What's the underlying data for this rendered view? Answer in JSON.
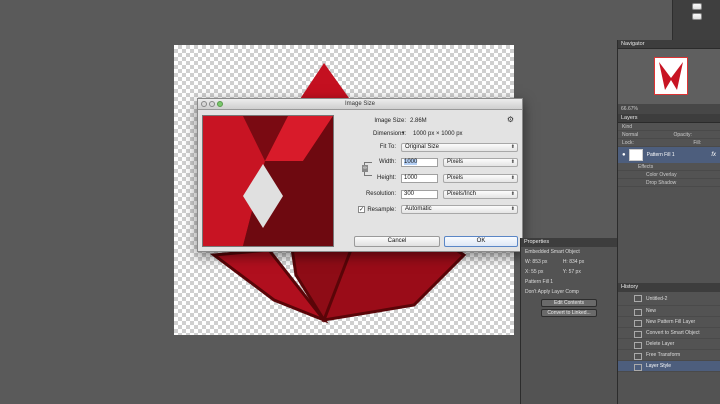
{
  "dialog": {
    "title": "Image Size",
    "image_size_label": "Image Size:",
    "image_size_value": "2.86M",
    "dimensions_label": "Dimensions:",
    "dimensions_value": "1000 px  ×  1000 px",
    "fit_to_label": "Fit To:",
    "fit_to_value": "Original Size",
    "width_label": "Width:",
    "width_value": "1000",
    "width_unit": "Pixels",
    "height_label": "Height:",
    "height_value": "1000",
    "height_unit": "Pixels",
    "resolution_label": "Resolution:",
    "resolution_value": "300",
    "resolution_unit": "Pixels/Inch",
    "resample_label": "Resample:",
    "resample_value": "Automatic",
    "resample_checked": "✓",
    "cancel_label": "Cancel",
    "ok_label": "OK"
  },
  "dock": {
    "navigator_tab": "Navigator",
    "zoom": "66.67%",
    "layers_tab": "Layers",
    "kind_filter": "Kind",
    "blend_mode": "Normal",
    "opacity_label": "Opacity:",
    "fill_label": "Fill:",
    "lock_label": "Lock:",
    "layer_name": "Pattern Fill 1",
    "fx": "fx",
    "effects_label": "Effects",
    "effect_1": "Color Overlay",
    "effect_2": "Drop Shadow"
  },
  "properties": {
    "tab": "Properties",
    "type": "Embedded Smart Object",
    "w": "W: 853 px",
    "h": "H: 834 px",
    "x": "X: 55 px",
    "y": "Y: 57 px",
    "layer_name": "Pattern Fill 1",
    "comps": "Don't Apply Layer Comp",
    "edit_contents": "Edit Contents",
    "convert_linked": "Convert to Linked..."
  },
  "history": {
    "tab": "History",
    "snapshot": "Untitled-2",
    "items": [
      "New",
      "New Pattern Fill Layer",
      "Convert to Smart Object",
      "Delete Layer",
      "Free Transform",
      "Layer Style"
    ]
  },
  "colors": {
    "dark_red": "#7a0a12",
    "red": "#c81423",
    "selection": "#4d5e7d"
  },
  "icons": [
    "gear-icon",
    "link-icon",
    "eye-icon",
    "chevron-down-icon"
  ]
}
